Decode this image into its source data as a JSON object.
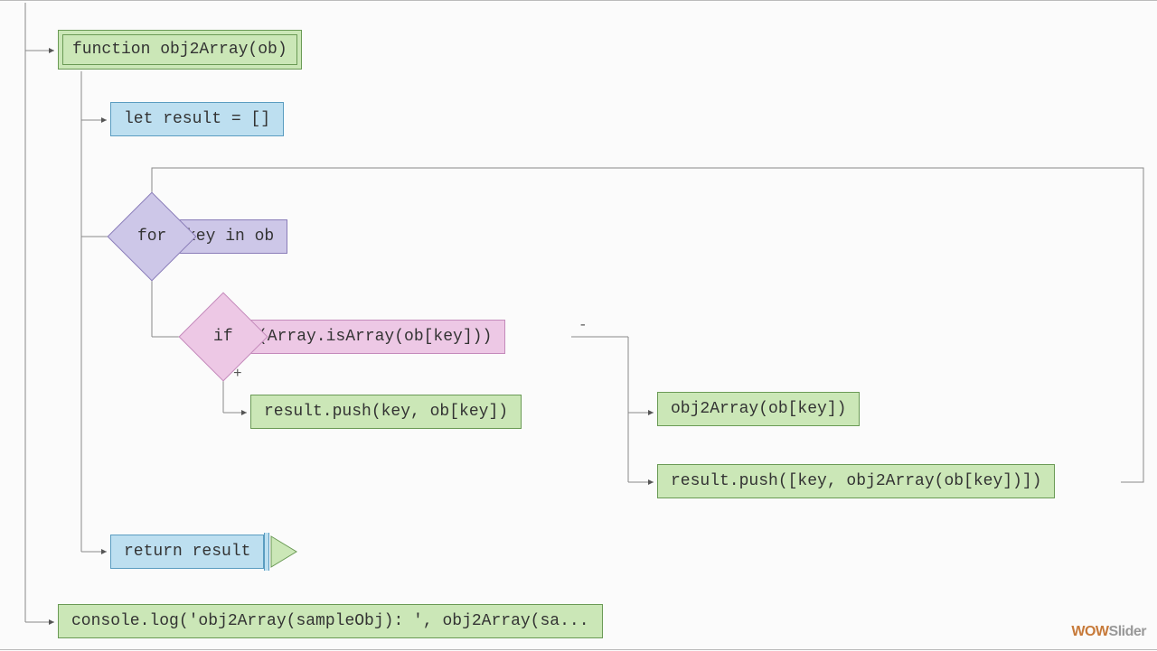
{
  "nodes": {
    "function_decl": "function obj2Array(ob)",
    "let_result": "let result = []",
    "for_kw": "for",
    "for_cond": "key in ob",
    "if_kw": "if",
    "if_cond": "(Array.isArray(ob[key]))",
    "true_branch": "result.push(key, ob[key])",
    "false_call": "obj2Array(ob[key])",
    "false_push": "result.push([key, obj2Array(ob[key])])",
    "return_stmt": "return result",
    "console_log": "console.log('obj2Array(sampleObj): ', obj2Array(sa..."
  },
  "labels": {
    "true": "+",
    "false": "-"
  },
  "watermark": {
    "wow": "WOW",
    "slider": "Slider"
  },
  "colors": {
    "green_fill": "#cbe7b7",
    "green_border": "#6a9a55",
    "blue_fill": "#bddff0",
    "blue_border": "#5a9cc0",
    "purple_fill": "#cdc7e8",
    "purple_border": "#8a7db8",
    "pink_fill": "#edc8e5",
    "pink_border": "#c48abb"
  }
}
